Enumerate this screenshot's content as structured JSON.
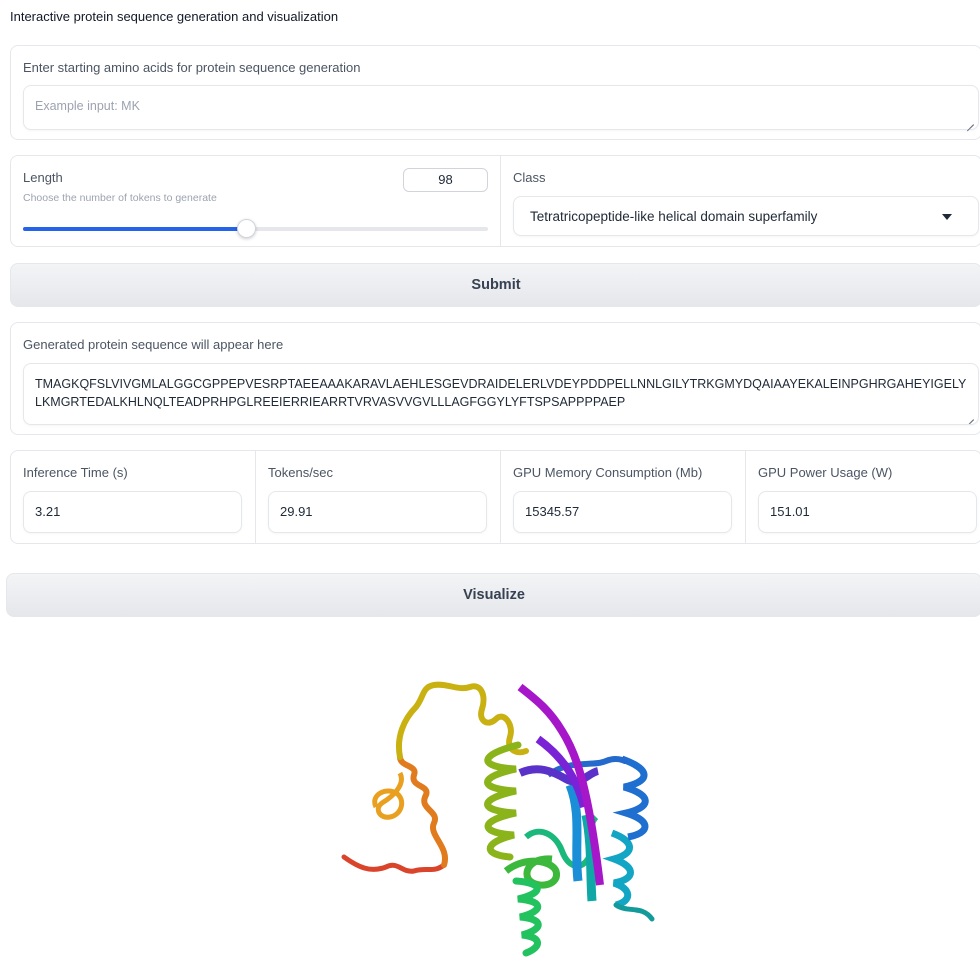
{
  "app": {
    "description": "Interactive protein sequence generation and visualization"
  },
  "input": {
    "label": "Enter starting amino acids for protein sequence generation",
    "placeholder": "Example input: MK",
    "value": ""
  },
  "length": {
    "label": "Length",
    "info": "Choose the number of tokens to generate",
    "value": "98",
    "fraction": 0.48
  },
  "class_select": {
    "label": "Class",
    "selected": "Tetratricopeptide-like helical domain superfamily"
  },
  "submit": {
    "label": "Submit"
  },
  "output": {
    "label": "Generated protein sequence will appear here",
    "sequence": "TMAGKQFSLVIVGMLALGGCGPPEPVESRPTAEEAAAKARAVLAEHLESGEVDRAIDELERLVDEYPDDPELLNNLGILYTRKGMYDQAIAAYEKALEINPGHRGAHEYIGELYLKMGRTEDALKHLNQLTEADPRHPGLREEIERRIEARRTVRVASVVGVLLLAGFGGYLYFTSPSAPPPPAEP"
  },
  "metrics": [
    {
      "label": "Inference Time (s)",
      "value": "3.21"
    },
    {
      "label": "Tokens/sec",
      "value": "29.91"
    },
    {
      "label": "GPU Memory Consumption (Mb)",
      "value": "15345.57"
    },
    {
      "label": "GPU Power Usage (W)",
      "value": "151.01"
    }
  ],
  "visualize": {
    "label": "Visualize"
  },
  "icons": {
    "dropdown": "caret-down-icon",
    "resize": "resize-grip-icon"
  },
  "colors": {
    "accent": "#2563eb",
    "border": "#e5e7eb",
    "button_bg": "#e5e7eb"
  }
}
